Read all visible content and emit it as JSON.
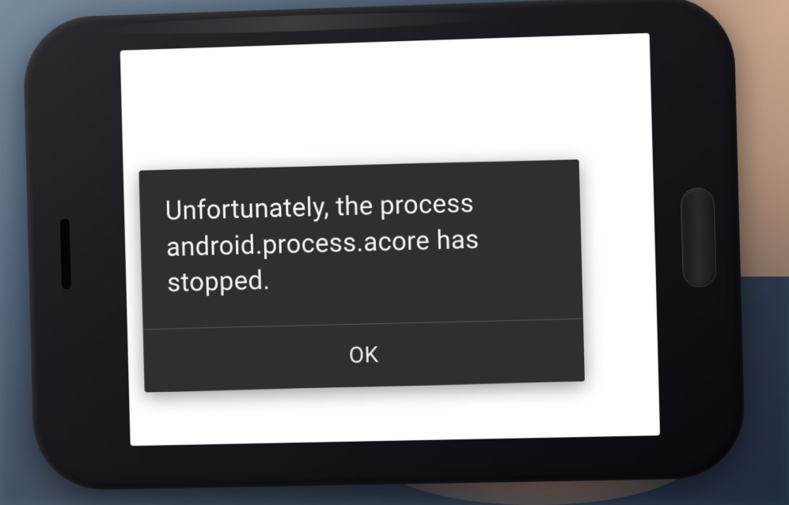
{
  "dialog": {
    "message": "Unfortunately, the process android.process.acore has stopped.",
    "ok_label": "OK"
  }
}
